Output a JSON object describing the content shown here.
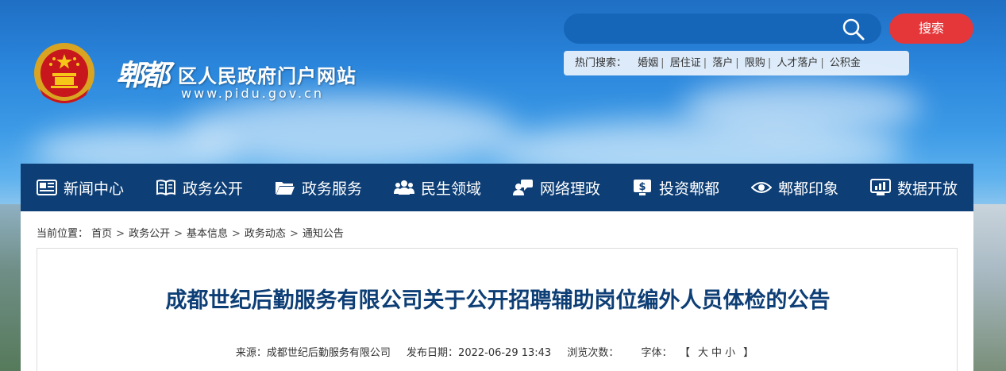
{
  "header": {
    "calligraphy": "郫都",
    "site_title": "区人民政府门户网站",
    "site_url": "www.pidu.gov.cn"
  },
  "search": {
    "placeholder": "",
    "button_label": "搜索",
    "hot_label": "热门搜索：",
    "hot_keywords": [
      "婚姻",
      "居住证",
      "落户",
      "限购",
      "人才落户",
      "公积金"
    ]
  },
  "nav": {
    "items": [
      {
        "label": "新闻中心",
        "icon": "newspaper-icon"
      },
      {
        "label": "政务公开",
        "icon": "book-icon"
      },
      {
        "label": "政务服务",
        "icon": "folder-icon"
      },
      {
        "label": "民生领域",
        "icon": "people-icon"
      },
      {
        "label": "网络理政",
        "icon": "chat-user-icon"
      },
      {
        "label": "投资郫都",
        "icon": "dollar-screen-icon"
      },
      {
        "label": "郫都印象",
        "icon": "eye-icon"
      },
      {
        "label": "数据开放",
        "icon": "data-screen-icon"
      }
    ]
  },
  "breadcrumb": {
    "label": "当前位置：",
    "items": [
      "首页",
      "政务公开",
      "基本信息",
      "政务动态",
      "通知公告"
    ]
  },
  "article": {
    "title": "成都世纪后勤服务有限公司关于公开招聘辅助岗位编外人员体检的公告",
    "source_label": "来源：成都世纪后勤服务有限公司",
    "date_label": "发布日期：2022-06-29 13:43",
    "views_label": "浏览次数：",
    "font_label": "字体：",
    "font_open": "【",
    "font_large": "大",
    "font_medium": "中",
    "font_small": "小",
    "font_close": "】"
  },
  "colors": {
    "nav_bg": "#0d3e75",
    "search_button": "#e5373a",
    "title_color": "#0d3e75"
  }
}
